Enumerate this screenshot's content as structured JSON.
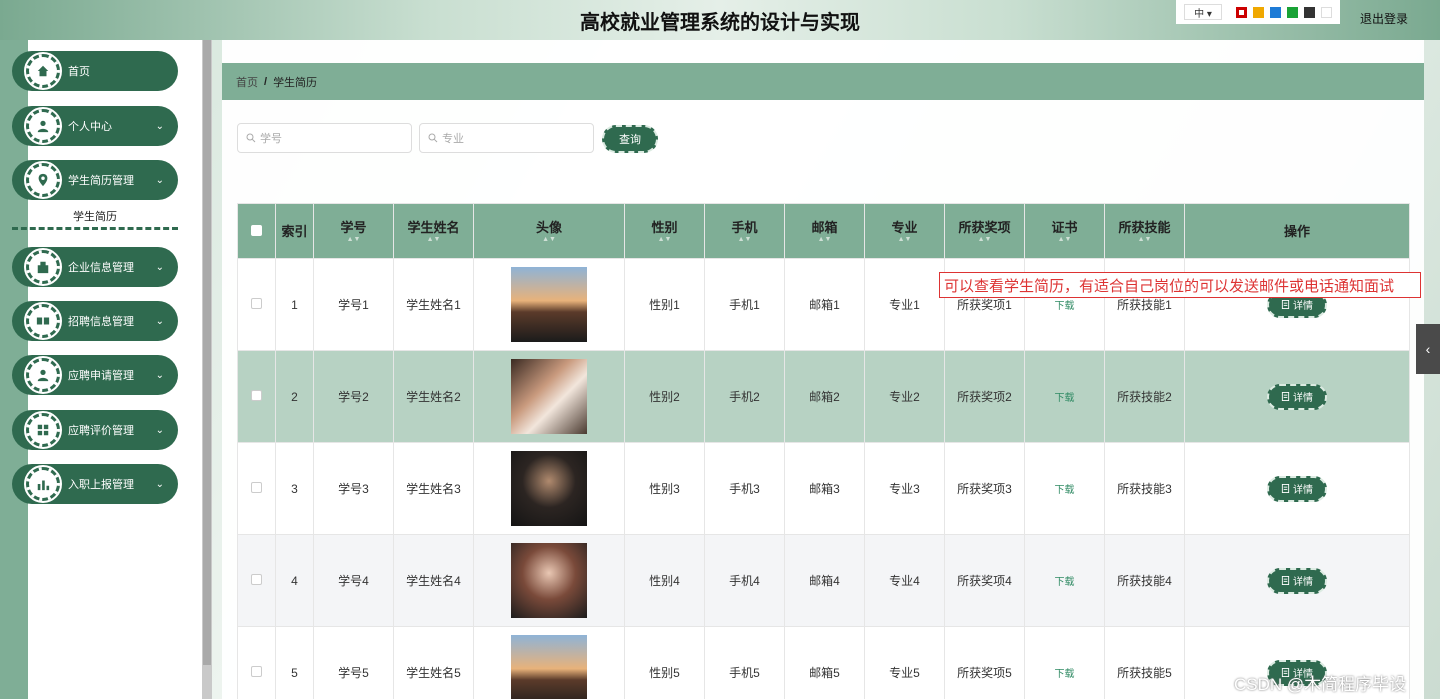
{
  "app": {
    "title": "高校就业管理系统的设计与实现",
    "logout": "退出登录",
    "lang": "中 ▾"
  },
  "theme_colors": [
    "#cc0000",
    "#f0a800",
    "#1e7bd6",
    "#1aa336",
    "#333333",
    "#ffffff"
  ],
  "sidebar": {
    "items": [
      {
        "label": "首页",
        "icon": "home-icon"
      },
      {
        "label": "个人中心",
        "icon": "user-icon"
      },
      {
        "label": "学生简历管理",
        "icon": "pin-icon"
      },
      {
        "label": "企业信息管理",
        "icon": "building-icon"
      },
      {
        "label": "招聘信息管理",
        "icon": "recruit-icon"
      },
      {
        "label": "应聘申请管理",
        "icon": "user-icon"
      },
      {
        "label": "应聘评价管理",
        "icon": "grid-icon"
      },
      {
        "label": "入职上报管理",
        "icon": "chart-icon"
      }
    ],
    "sub": "学生简历"
  },
  "breadcrumb": {
    "home": "首页",
    "sep": "/",
    "current": "学生简历"
  },
  "search": {
    "f1": "学号",
    "f2": "专业",
    "btn": "查询"
  },
  "table": {
    "headers": [
      "索引",
      "学号",
      "学生姓名",
      "头像",
      "性别",
      "手机",
      "邮箱",
      "专业",
      "所获奖项",
      "证书",
      "所获技能",
      "操作"
    ],
    "rows": [
      {
        "idx": "1",
        "xh": "学号1",
        "xm": "学生姓名1",
        "xb": "性别1",
        "sj": "手机1",
        "yx": "邮箱1",
        "zy": "专业1",
        "jx": "所获奖项1",
        "zs": "下载",
        "jn": "所获技能1",
        "op": "详情"
      },
      {
        "idx": "2",
        "xh": "学号2",
        "xm": "学生姓名2",
        "xb": "性别2",
        "sj": "手机2",
        "yx": "邮箱2",
        "zy": "专业2",
        "jx": "所获奖项2",
        "zs": "下载",
        "jn": "所获技能2",
        "op": "详情"
      },
      {
        "idx": "3",
        "xh": "学号3",
        "xm": "学生姓名3",
        "xb": "性别3",
        "sj": "手机3",
        "yx": "邮箱3",
        "zy": "专业3",
        "jx": "所获奖项3",
        "zs": "下载",
        "jn": "所获技能3",
        "op": "详情"
      },
      {
        "idx": "4",
        "xh": "学号4",
        "xm": "学生姓名4",
        "xb": "性别4",
        "sj": "手机4",
        "yx": "邮箱4",
        "zy": "专业4",
        "jx": "所获奖项4",
        "zs": "下载",
        "jn": "所获技能4",
        "op": "详情"
      },
      {
        "idx": "5",
        "xh": "学号5",
        "xm": "学生姓名5",
        "xb": "性别5",
        "sj": "手机5",
        "yx": "邮箱5",
        "zy": "专业5",
        "jx": "所获奖项5",
        "zs": "下载",
        "jn": "所获技能5",
        "op": "详情"
      }
    ]
  },
  "annotation": "可以查看学生简历，有适合自己岗位的可以发送邮件或电话通知面试",
  "watermark": "CSDN @木简程序毕设"
}
